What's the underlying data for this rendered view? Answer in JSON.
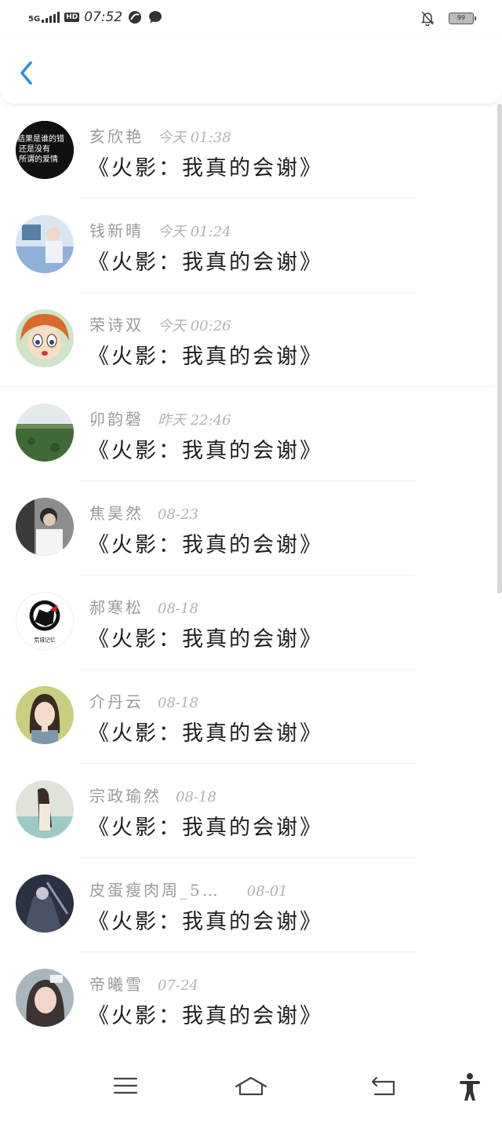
{
  "status": {
    "network": "5G",
    "hd": "HD",
    "time": "07:52",
    "battery": "99"
  },
  "messages": [
    {
      "name": "亥欣艳",
      "time": "今天 01:38",
      "text": "《火影：我真的会谢》",
      "avatar_color": "#111111"
    },
    {
      "name": "钱新晴",
      "time": "今天 01:24",
      "text": "《火影：我真的会谢》",
      "avatar_color": "#7fa7d6"
    },
    {
      "name": "荣诗双",
      "time": "今天 00:26",
      "text": "《火影：我真的会谢》",
      "avatar_color": "#e07a3a"
    },
    {
      "name": "卯韵磬",
      "time": "昨天 22:46",
      "text": "《火影：我真的会谢》",
      "avatar_color": "#4c6b3a"
    },
    {
      "name": "焦昊然",
      "time": "08-23",
      "text": "《火影：我真的会谢》",
      "avatar_color": "#6b6b6b"
    },
    {
      "name": "郝寒松",
      "time": "08-18",
      "text": "《火影：我真的会谢》",
      "avatar_color": "#ffffff"
    },
    {
      "name": "介丹云",
      "time": "08-18",
      "text": "《火影：我真的会谢》",
      "avatar_color": "#b8c57a"
    },
    {
      "name": "宗政瑜然",
      "time": "08-18",
      "text": "《火影：我真的会谢》",
      "avatar_color": "#c9c9b8"
    },
    {
      "name": "皮蛋瘦肉周_5…",
      "time": "08-01",
      "text": "《火影：我真的会谢》",
      "avatar_color": "#2d3342"
    },
    {
      "name": "帝曦雪",
      "time": "07-24",
      "text": "《火影：我真的会谢》",
      "avatar_color": "#aab3b8"
    }
  ],
  "first_avatar_text": [
    "结果是谁的错",
    "还是没有",
    "所谓的爱情"
  ],
  "sixth_avatar_caption": "荒城记忆"
}
